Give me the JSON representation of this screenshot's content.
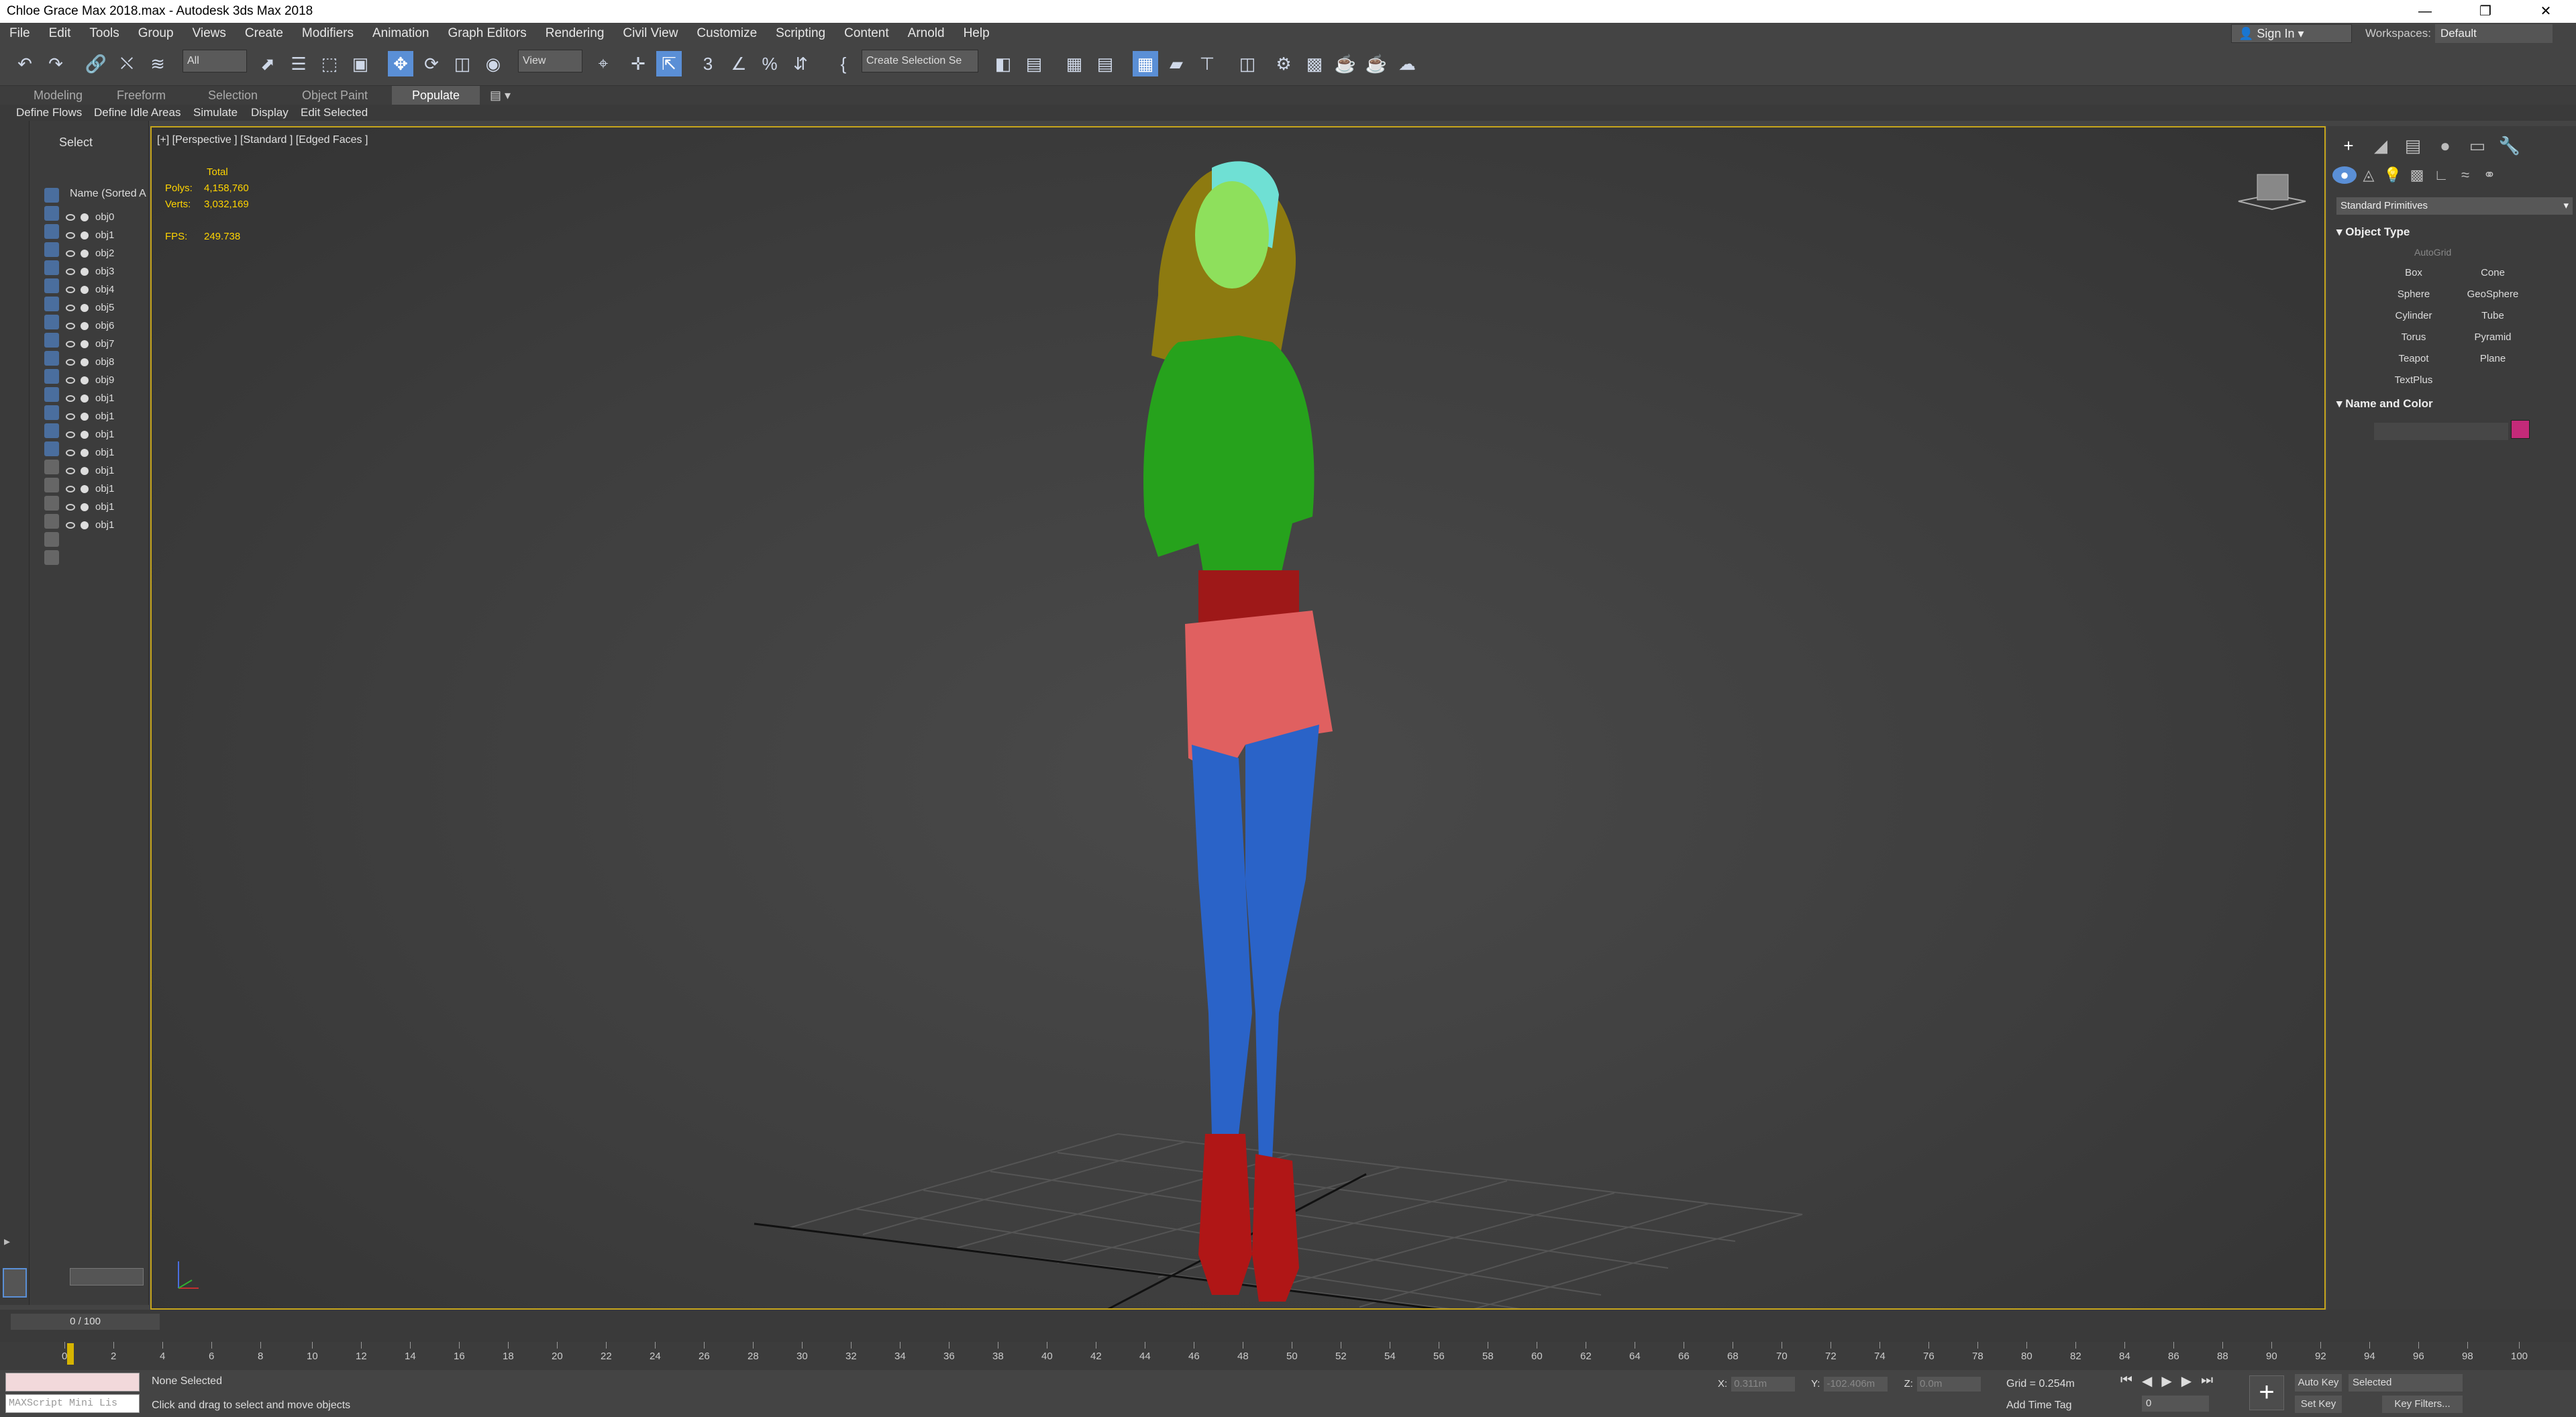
{
  "window": {
    "title": "Chloe Grace Max 2018.max - Autodesk 3ds Max 2018"
  },
  "menu": [
    "File",
    "Edit",
    "Tools",
    "Group",
    "Views",
    "Create",
    "Modifiers",
    "Animation",
    "Graph Editors",
    "Rendering",
    "Civil View",
    "Customize",
    "Scripting",
    "Content",
    "Arnold",
    "Help"
  ],
  "account": {
    "sign_in": "Sign In",
    "workspaces_label": "Workspaces:",
    "workspace": "Default"
  },
  "toolbar": {
    "filter": "All",
    "ref_coord": "View",
    "selection_set": "Create Selection Se"
  },
  "ribbon": {
    "tabs": [
      "Modeling",
      "Freeform",
      "Selection",
      "Object Paint",
      "Populate"
    ],
    "active_tab": "Populate",
    "panel": [
      "Define Flows",
      "Define Idle Areas",
      "Simulate",
      "Display",
      "Edit Selected"
    ]
  },
  "scene_explorer": {
    "tab": "Select",
    "header": "Name (Sorted A",
    "objects": [
      "obj0",
      "obj1",
      "obj2",
      "obj3",
      "obj4",
      "obj5",
      "obj6",
      "obj7",
      "obj8",
      "obj9",
      "obj1",
      "obj1",
      "obj1",
      "obj1",
      "obj1",
      "obj1",
      "obj1",
      "obj1"
    ]
  },
  "viewport": {
    "label": "[+] [Perspective ] [Standard ] [Edged Faces ]",
    "stats": {
      "total_label": "Total",
      "polys_label": "Polys:",
      "polys": "4,158,760",
      "verts_label": "Verts:",
      "verts": "3,032,169",
      "fps_label": "FPS:",
      "fps": "249.738"
    }
  },
  "command_panel": {
    "dropdown": "Standard Primitives",
    "object_type": "Object Type",
    "autogrid": "AutoGrid",
    "primitives": [
      "Box",
      "Cone",
      "Sphere",
      "GeoSphere",
      "Cylinder",
      "Tube",
      "Torus",
      "Pyramid",
      "Teapot",
      "Plane",
      "TextPlus"
    ],
    "name_and_color": "Name and Color",
    "color": "#c42a79"
  },
  "timeline": {
    "slider": "0 / 100",
    "ticks": [
      "0",
      "2",
      "4",
      "6",
      "8",
      "10",
      "12",
      "14",
      "16",
      "18",
      "20",
      "22",
      "24",
      "26",
      "28",
      "30",
      "32",
      "34",
      "36",
      "38",
      "40",
      "42",
      "44",
      "46",
      "48",
      "50",
      "52",
      "54",
      "56",
      "58",
      "60",
      "62",
      "64",
      "66",
      "68",
      "70",
      "72",
      "74",
      "76",
      "78",
      "80",
      "82",
      "84",
      "86",
      "88",
      "90",
      "92",
      "94",
      "96",
      "98",
      "100"
    ]
  },
  "status": {
    "maxscript": "MAXScript Mini Lis",
    "selection": "None Selected",
    "hint": "Click and drag to select and move objects",
    "x_label": "X:",
    "x": "0.311m",
    "y_label": "Y:",
    "y": "-102.406m",
    "z_label": "Z:",
    "z": "0.0m",
    "grid": "Grid = 0.254m",
    "add_time_tag": "Add Time Tag",
    "frame": "0",
    "auto_key": "Auto Key",
    "set_key": "Set Key",
    "key_mode": "Selected",
    "key_filters": "Key Filters..."
  }
}
